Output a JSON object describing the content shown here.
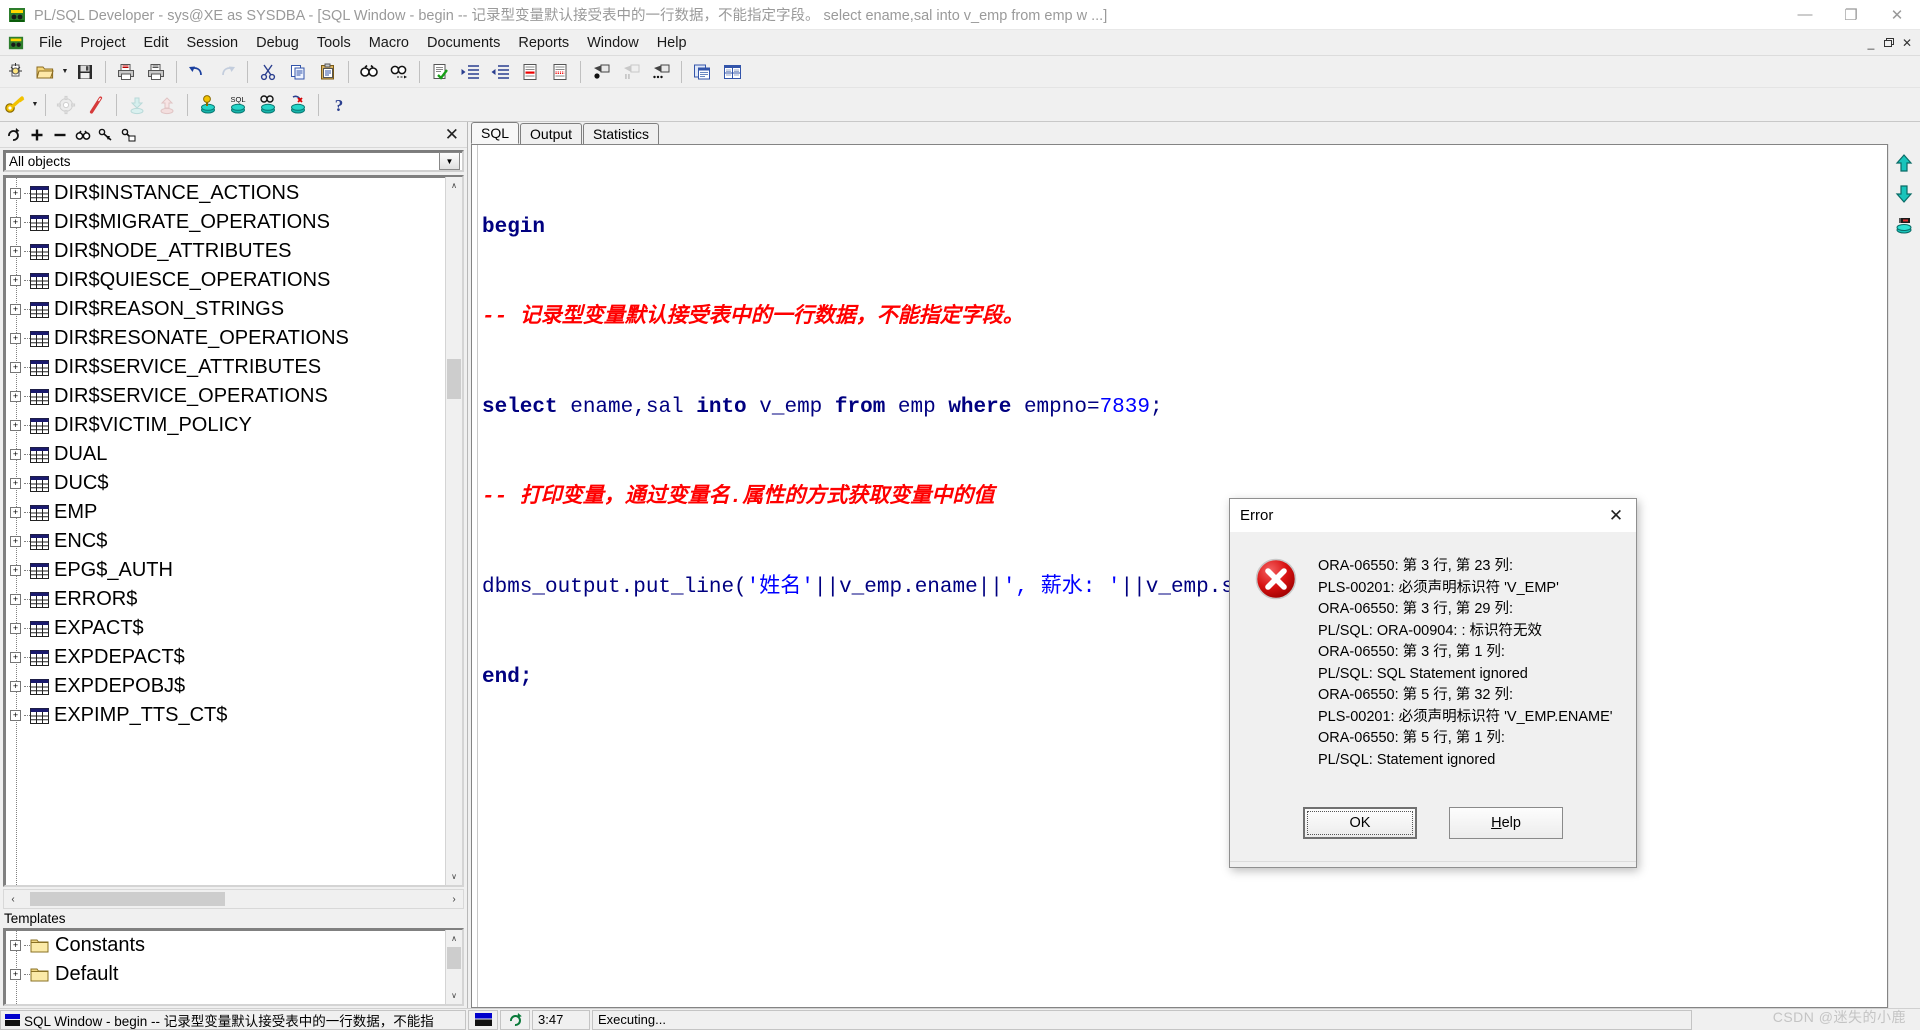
{
  "window": {
    "title": "PL/SQL Developer - sys@XE as SYSDBA - [SQL Window - begin -- 记录型变量默认接受表中的一行数据，不能指定字段。 select ename,sal into v_emp from emp w ...]",
    "minimize": "—",
    "maximize": "❐",
    "close": "✕",
    "mdi_minimize": "_",
    "mdi_restore": "❐",
    "mdi_close": "✕"
  },
  "menu": {
    "items": [
      {
        "label": "File"
      },
      {
        "label": "Project"
      },
      {
        "label": "Edit"
      },
      {
        "label": "Session"
      },
      {
        "label": "Debug"
      },
      {
        "label": "Tools"
      },
      {
        "label": "Macro"
      },
      {
        "label": "Documents"
      },
      {
        "label": "Reports"
      },
      {
        "label": "Window"
      },
      {
        "label": "Help"
      }
    ]
  },
  "toolbar1": {
    "buttons": [
      {
        "name": "new-icon"
      },
      {
        "name": "open-folder-icon"
      },
      {
        "name": "save-icon"
      },
      {
        "name": "print-icon"
      },
      {
        "name": "print-preview-icon"
      },
      {
        "name": "undo-icon"
      },
      {
        "name": "redo-icon"
      },
      {
        "name": "cut-icon"
      },
      {
        "name": "copy-icon"
      },
      {
        "name": "paste-icon"
      },
      {
        "name": "find-icon"
      },
      {
        "name": "find-next-icon"
      },
      {
        "name": "check-syntax-icon"
      },
      {
        "name": "indent-icon"
      },
      {
        "name": "outdent-icon"
      },
      {
        "name": "comment-icon"
      },
      {
        "name": "uncomment-icon"
      },
      {
        "name": "execute-icon"
      },
      {
        "name": "break-icon"
      },
      {
        "name": "execute-all-icon"
      },
      {
        "name": "copy-window-icon"
      },
      {
        "name": "tile-windows-icon"
      }
    ]
  },
  "toolbar2": {
    "buttons": [
      {
        "name": "session-key-icon"
      },
      {
        "name": "gear-icon"
      },
      {
        "name": "rollback-icon"
      },
      {
        "name": "import-icon"
      },
      {
        "name": "export-icon"
      },
      {
        "name": "test-window-icon"
      },
      {
        "name": "sql-window-icon"
      },
      {
        "name": "explain-plan-icon"
      },
      {
        "name": "kill-session-icon"
      },
      {
        "name": "help-icon"
      }
    ]
  },
  "browser": {
    "toolbar": [
      {
        "name": "refresh-icon"
      },
      {
        "name": "add-icon"
      },
      {
        "name": "remove-icon"
      },
      {
        "name": "find-objects-icon"
      },
      {
        "name": "filter-icon"
      },
      {
        "name": "folder-filter-icon"
      }
    ],
    "close_label": "✕",
    "filter": {
      "value": "All objects",
      "arrow": "▼"
    },
    "objects": [
      {
        "label": "DIR$INSTANCE_ACTIONS",
        "type": "table"
      },
      {
        "label": "DIR$MIGRATE_OPERATIONS",
        "type": "table"
      },
      {
        "label": "DIR$NODE_ATTRIBUTES",
        "type": "table"
      },
      {
        "label": "DIR$QUIESCE_OPERATIONS",
        "type": "table"
      },
      {
        "label": "DIR$REASON_STRINGS",
        "type": "table"
      },
      {
        "label": "DIR$RESONATE_OPERATIONS",
        "type": "table"
      },
      {
        "label": "DIR$SERVICE_ATTRIBUTES",
        "type": "table"
      },
      {
        "label": "DIR$SERVICE_OPERATIONS",
        "type": "table"
      },
      {
        "label": "DIR$VICTIM_POLICY",
        "type": "table"
      },
      {
        "label": "DUAL",
        "type": "table"
      },
      {
        "label": "DUC$",
        "type": "table"
      },
      {
        "label": "EMP",
        "type": "table"
      },
      {
        "label": "ENC$",
        "type": "table"
      },
      {
        "label": "EPG$_AUTH",
        "type": "table"
      },
      {
        "label": "ERROR$",
        "type": "table"
      },
      {
        "label": "EXPACT$",
        "type": "table"
      },
      {
        "label": "EXPDEPACT$",
        "type": "table"
      },
      {
        "label": "EXPDEPOBJ$",
        "type": "table"
      },
      {
        "label": "EXPIMP_TTS_CT$",
        "type": "table"
      }
    ],
    "expander_glyph": "+",
    "scroll_up": "∧",
    "scroll_down": "∨",
    "scroll_left": "‹",
    "scroll_right": "›"
  },
  "templates": {
    "header": "Templates",
    "items": [
      {
        "label": "Constants"
      },
      {
        "label": "Default"
      }
    ]
  },
  "editor": {
    "tabs": [
      {
        "label": "SQL",
        "active": true
      },
      {
        "label": "Output",
        "active": false
      },
      {
        "label": "Statistics",
        "active": false
      }
    ],
    "code_lines": [
      [
        {
          "t": "begin",
          "c": "kw"
        }
      ],
      [
        {
          "t": "-- ",
          "c": "cmt"
        },
        {
          "t": "记录型变量默认接受表中的一行数据，不能指定字段。",
          "c": "cmt"
        }
      ],
      [
        {
          "t": "select",
          "c": "kw"
        },
        {
          "t": " ename,sal ",
          "c": "ident"
        },
        {
          "t": "into",
          "c": "kw"
        },
        {
          "t": " v_emp ",
          "c": "ident"
        },
        {
          "t": "from",
          "c": "kw"
        },
        {
          "t": " emp ",
          "c": "ident"
        },
        {
          "t": "where",
          "c": "kw"
        },
        {
          "t": " empno=",
          "c": "ident"
        },
        {
          "t": "7839",
          "c": "num"
        },
        {
          "t": ";",
          "c": "ident"
        }
      ],
      [
        {
          "t": "-- ",
          "c": "cmt"
        },
        {
          "t": "打印变量，通过变量名.属性的方式获取变量中的值",
          "c": "cmt"
        }
      ],
      [
        {
          "t": "dbms_output.put_line(",
          "c": "ident"
        },
        {
          "t": "'姓名'",
          "c": "str"
        },
        {
          "t": "||v_emp.ename||",
          "c": "ident"
        },
        {
          "t": "', 薪水: '",
          "c": "str"
        },
        {
          "t": "||v_emp.sal);",
          "c": "ident"
        }
      ],
      [
        {
          "t": "end;",
          "c": "kw"
        }
      ]
    ],
    "side_buttons": [
      {
        "name": "scroll-up-icon"
      },
      {
        "name": "scroll-down-icon"
      },
      {
        "name": "db-session-icon"
      }
    ]
  },
  "dialog": {
    "title": "Error",
    "close": "✕",
    "icon": "error-icon",
    "messages": [
      "ORA-06550: 第 3 行, 第 23 列:",
      "PLS-00201: 必须声明标识符 'V_EMP'",
      "ORA-06550: 第 3 行, 第 29 列:",
      "PL/SQL: ORA-00904: : 标识符无效",
      "ORA-06550: 第 3 行, 第 1 列:",
      "PL/SQL: SQL Statement ignored",
      "ORA-06550: 第 5 行, 第 32 列:",
      "PLS-00201: 必须声明标识符 'V_EMP.ENAME'",
      "ORA-06550: 第 5 行, 第 1 列:",
      "PL/SQL: Statement ignored"
    ],
    "ok_label": "OK",
    "help_label_prefix": "H",
    "help_label_rest": "elp"
  },
  "statusbar": {
    "window_label": "SQL Window - begin -- 记录型变量默认接受表中的一行数据，不能指",
    "refresh_icon": "↺",
    "time": "3:47",
    "status": "Executing...",
    "watermark": "CSDN @迷失的小鹿"
  },
  "colors": {
    "keyword": "#000080",
    "comment": "#ff0000",
    "number": "#0000ff",
    "string": "#0000ff",
    "error_red": "#cc0000",
    "titlebar_text": "#9a9a9a"
  }
}
